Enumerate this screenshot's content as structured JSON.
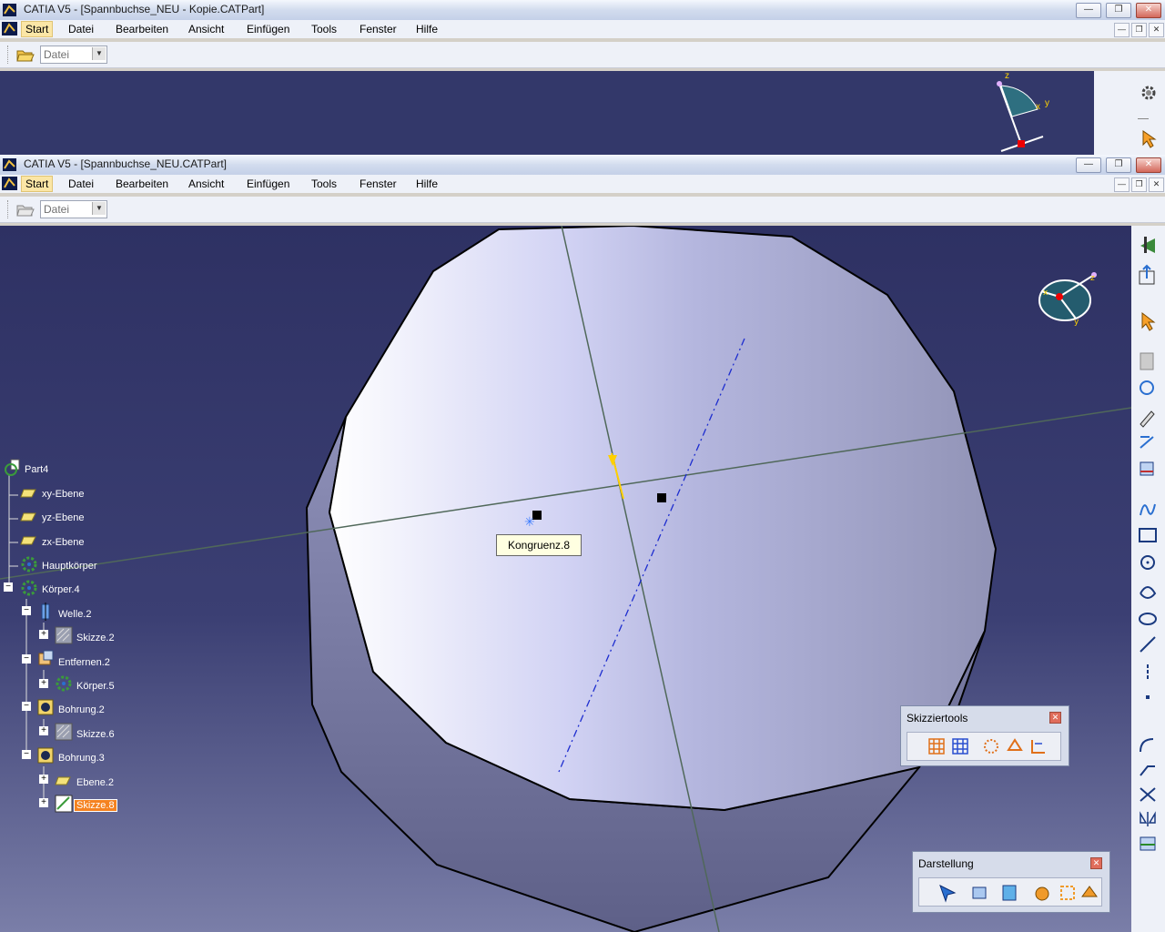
{
  "window1": {
    "title": "CATIA V5 - [Spannbuchse_NEU - Kopie.CATPart]",
    "menu": [
      "Start",
      "Datei",
      "Bearbeiten",
      "Ansicht",
      "Einfügen",
      "Tools",
      "Fenster",
      "Hilfe"
    ],
    "combo_value": "Datei"
  },
  "window2": {
    "title": "CATIA V5 - [Spannbuchse_NEU.CATPart]",
    "menu": [
      "Start",
      "Datei",
      "Bearbeiten",
      "Ansicht",
      "Einfügen",
      "Tools",
      "Fenster",
      "Hilfe"
    ],
    "combo_value": "Datei"
  },
  "caption_buttons": {
    "minimize": "—",
    "restore": "❐",
    "close": "✕"
  },
  "compass": {
    "z": "z",
    "x": "x",
    "y": "y"
  },
  "tree": [
    {
      "label": "Part4",
      "icon": "part-icon",
      "expander": ""
    },
    {
      "label": "xy-Ebene",
      "icon": "plane-icon",
      "expander": ""
    },
    {
      "label": "yz-Ebene",
      "icon": "plane-icon",
      "expander": ""
    },
    {
      "label": "zx-Ebene",
      "icon": "plane-icon",
      "expander": ""
    },
    {
      "label": "Hauptkörper",
      "icon": "body-icon",
      "expander": ""
    },
    {
      "label": "Körper.4",
      "icon": "body-icon",
      "expander": "−"
    },
    {
      "label": "Welle.2",
      "icon": "shaft-icon",
      "expander": "−"
    },
    {
      "label": "Skizze.2",
      "icon": "sketch-icon",
      "expander": "+"
    },
    {
      "label": "Entfernen.2",
      "icon": "remove-icon",
      "expander": "−"
    },
    {
      "label": "Körper.5",
      "icon": "body-icon",
      "expander": "+"
    },
    {
      "label": "Bohrung.2",
      "icon": "hole-icon",
      "expander": "−"
    },
    {
      "label": "Skizze.6",
      "icon": "sketch-icon",
      "expander": "+"
    },
    {
      "label": "Bohrung.3",
      "icon": "hole-icon",
      "expander": "−"
    },
    {
      "label": "Ebene.2",
      "icon": "plane-icon",
      "expander": "+"
    },
    {
      "label": "Skizze.8",
      "icon": "sketch-icon",
      "expander": "+",
      "selected": true
    }
  ],
  "tooltip": "Kongruenz.8",
  "panels": {
    "skizziertools": {
      "title": "Skizziertools",
      "close": "✕"
    },
    "darstellung": {
      "title": "Darstellung",
      "close": "✕"
    }
  },
  "colors": {
    "viewport_bg": "#33386a",
    "selection": "#f58220",
    "tooltip_bg": "#ffffe1",
    "part_face": "#a7a9cf",
    "constraint_line": "#1d2dcf"
  }
}
